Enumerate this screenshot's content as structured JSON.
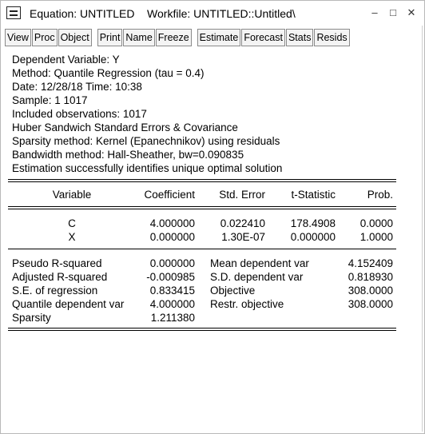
{
  "window": {
    "title": "Equation: UNTITLED    Workfile: UNTITLED::Untitled\\",
    "min_label": "–",
    "max_label": "□",
    "close_label": "✕"
  },
  "toolbar": [
    "View",
    "Proc",
    "Object",
    "Print",
    "Name",
    "Freeze",
    "Estimate",
    "Forecast",
    "Stats",
    "Resids"
  ],
  "header_lines": [
    "Dependent Variable: Y",
    "Method: Quantile Regression (tau = 0.4)",
    "Date: 12/28/18   Time: 10:38",
    "Sample: 1 1017",
    "Included observations: 1017",
    "Huber Sandwich Standard Errors & Covariance",
    "Sparsity method: Kernel (Epanechnikov) using residuals",
    "Bandwidth method: Hall-Sheather, bw=0.090835",
    "Estimation successfully identifies unique optimal solution"
  ],
  "coef_table": {
    "columns": [
      "Variable",
      "Coefficient",
      "Std. Error",
      "t-Statistic",
      "Prob."
    ],
    "rows": [
      [
        "C",
        "4.000000",
        "0.022410",
        "178.4908",
        "0.0000"
      ],
      [
        "X",
        "0.000000",
        "1.30E-07",
        "0.000000",
        "1.0000"
      ]
    ]
  },
  "stats": {
    "left": [
      [
        "Pseudo R-squared",
        "0.000000"
      ],
      [
        "Adjusted R-squared",
        "-0.000985"
      ],
      [
        "S.E. of regression",
        "0.833415"
      ],
      [
        "Quantile dependent var",
        "4.000000"
      ],
      [
        "Sparsity",
        "1.211380"
      ]
    ],
    "right": [
      [
        "Mean dependent var",
        "4.152409"
      ],
      [
        "S.D. dependent var",
        "0.818930"
      ],
      [
        "Objective",
        "308.0000"
      ],
      [
        "Restr. objective",
        "308.0000"
      ]
    ]
  }
}
